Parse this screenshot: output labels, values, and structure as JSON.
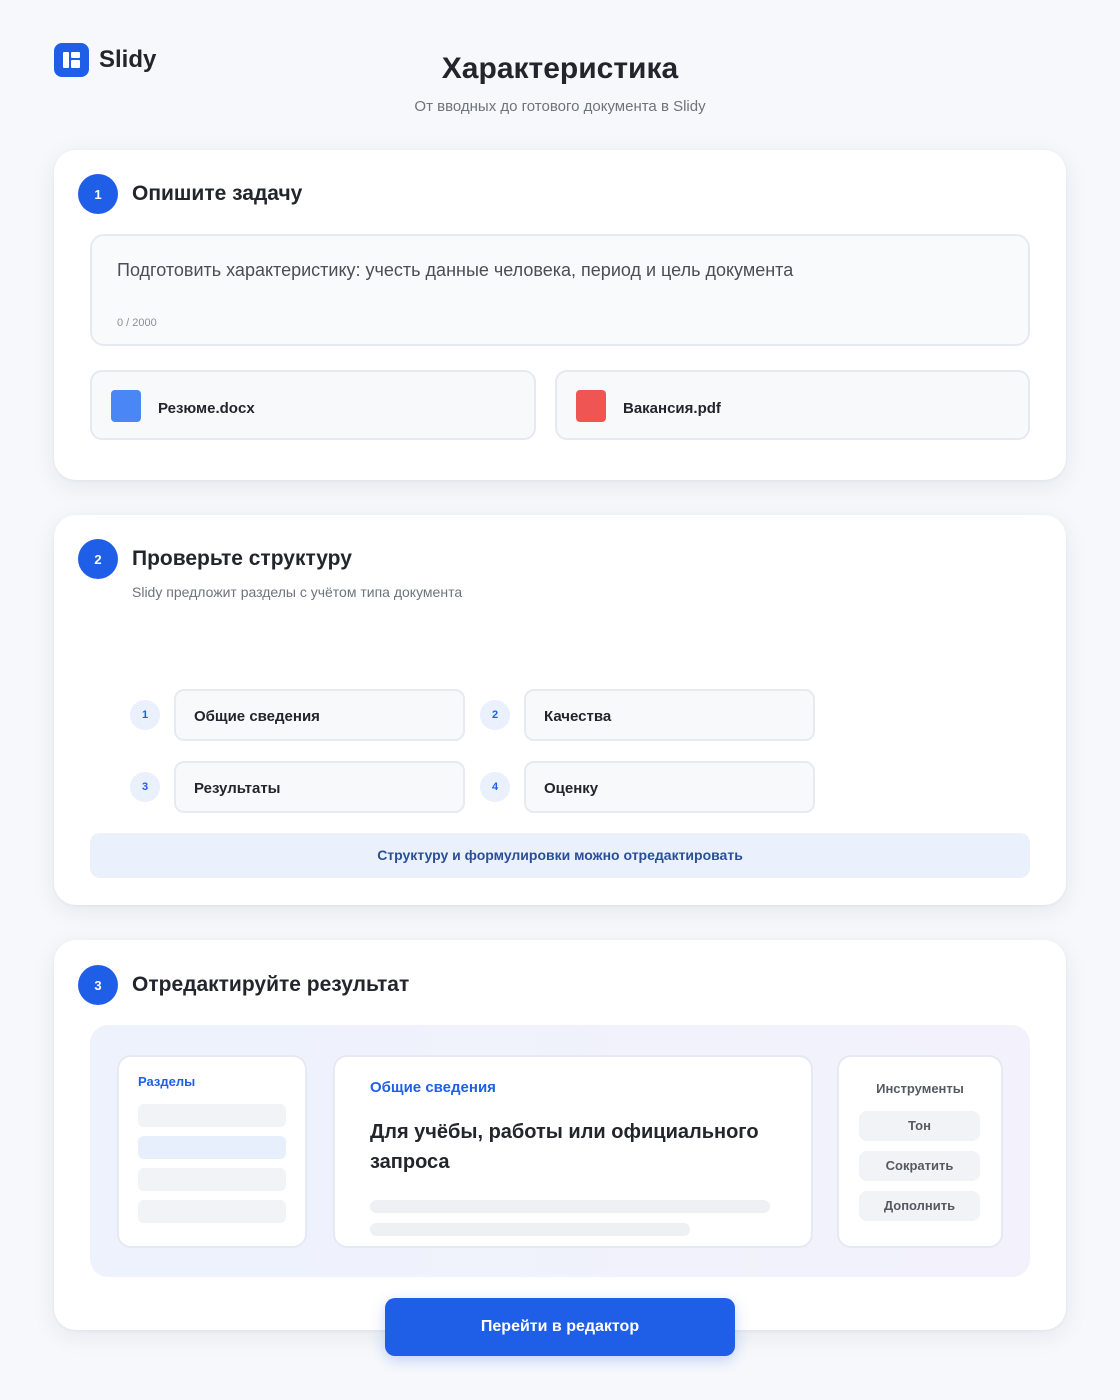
{
  "header": {
    "logo_text": "Slidy",
    "title": "Характеристика",
    "subtitle": "От вводных до готового документа в Slidy"
  },
  "step1": {
    "number": "1",
    "title": "Опишите задачу",
    "task_text": "Подготовить характеристику: учесть данные человека, период и цель документа",
    "char_count": "0 / 2000",
    "files": [
      {
        "name": "Резюме.docx",
        "icon_color": "#4a86f6"
      },
      {
        "name": "Вакансия.pdf",
        "icon_color": "#ef5552"
      }
    ]
  },
  "step2": {
    "number": "2",
    "title": "Проверьте структуру",
    "description": "Slidy предложит разделы с учётом типа документа",
    "sections": [
      {
        "num": "1",
        "label": "Общие сведения"
      },
      {
        "num": "2",
        "label": "Качества"
      },
      {
        "num": "3",
        "label": "Результаты"
      },
      {
        "num": "4",
        "label": "Оценку"
      }
    ],
    "note": "Структуру и формулировки можно отредактировать"
  },
  "step3": {
    "number": "3",
    "title": "Отредактируйте результат",
    "sections_heading": "Разделы",
    "content_heading": "Общие сведения",
    "content_title": "Для учёбы, работы или официального запроса",
    "tools_heading": "Инструменты",
    "tools": [
      "Тон",
      "Сократить",
      "Дополнить"
    ]
  },
  "cta_label": "Перейти в редактор",
  "colors": {
    "accent": "#1f5fe8",
    "docx_icon": "#4a86f6",
    "pdf_icon": "#ef5552"
  }
}
